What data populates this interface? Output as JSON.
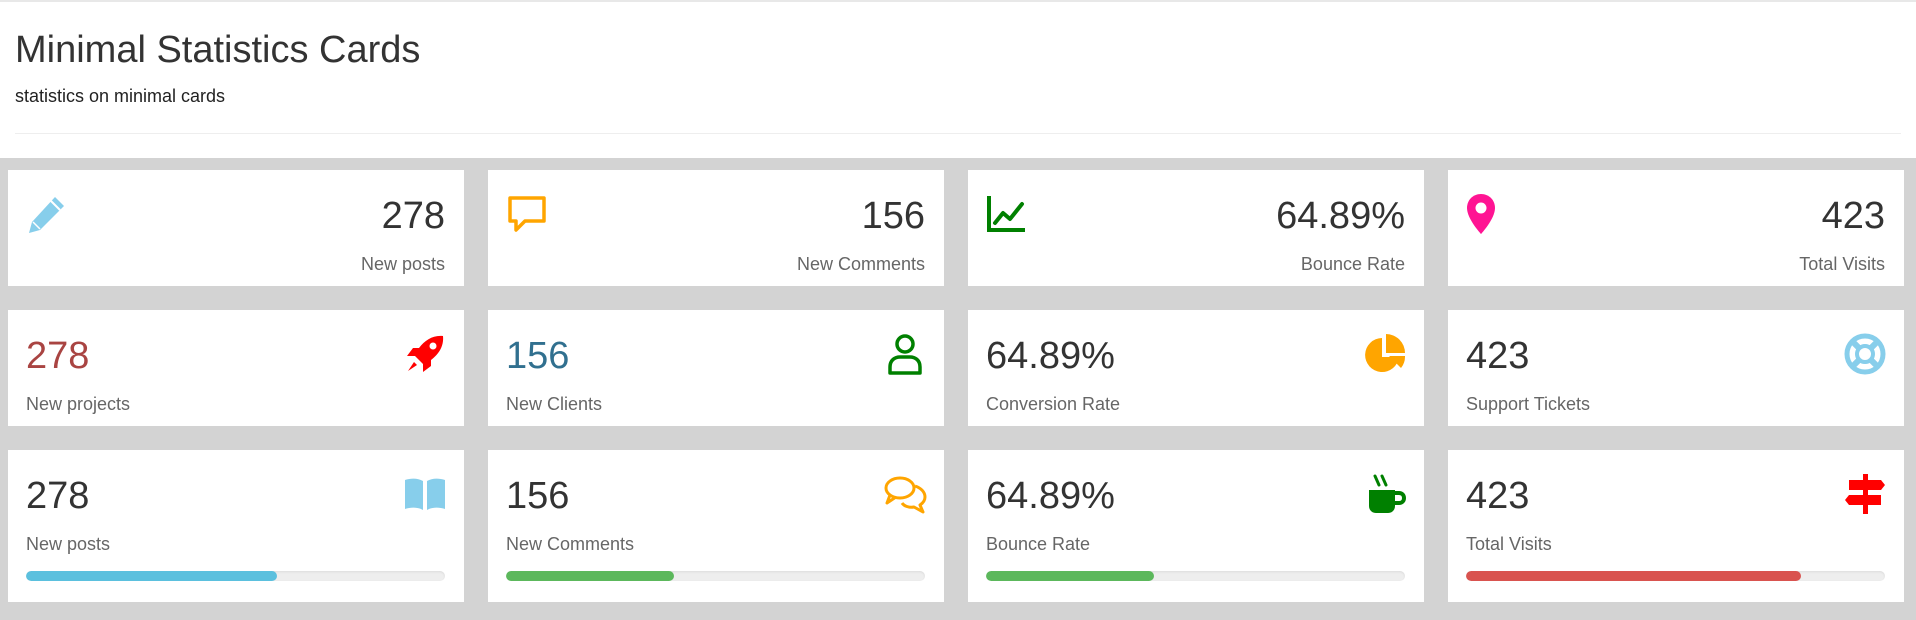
{
  "header": {
    "title": "Minimal Statistics Cards",
    "subtitle": "statistics on minimal cards"
  },
  "row1": [
    {
      "value": "278",
      "label": "New posts",
      "icon": "pencil-icon",
      "icon_color": "#87ceeb"
    },
    {
      "value": "156",
      "label": "New Comments",
      "icon": "comment-icon",
      "icon_color": "#ffa500"
    },
    {
      "value": "64.89%",
      "label": "Bounce Rate",
      "icon": "line-chart-icon",
      "icon_color": "#008000"
    },
    {
      "value": "423",
      "label": "Total Visits",
      "icon": "map-pin-icon",
      "icon_color": "#ff1493"
    }
  ],
  "row2": [
    {
      "value": "278",
      "label": "New projects",
      "icon": "rocket-icon",
      "icon_color": "#ff0000",
      "value_color": "#a94442"
    },
    {
      "value": "156",
      "label": "New Clients",
      "icon": "user-icon",
      "icon_color": "#008000",
      "value_color": "#31708f"
    },
    {
      "value": "64.89%",
      "label": "Conversion Rate",
      "icon": "pie-chart-icon",
      "icon_color": "#ffa500",
      "value_color": "#333333"
    },
    {
      "value": "423",
      "label": "Support Tickets",
      "icon": "life-ring-icon",
      "icon_color": "#87ceeb",
      "value_color": "#333333"
    }
  ],
  "row3": [
    {
      "value": "278",
      "label": "New posts",
      "icon": "book-open-icon",
      "icon_color": "#87ceeb",
      "progress": 0.6,
      "bar_color": "#5bc0de"
    },
    {
      "value": "156",
      "label": "New Comments",
      "icon": "comments-icon",
      "icon_color": "#ffa500",
      "progress": 0.4,
      "bar_color": "#5cb85c"
    },
    {
      "value": "64.89%",
      "label": "Bounce Rate",
      "icon": "coffee-cup-icon",
      "icon_color": "#008000",
      "progress": 0.4,
      "bar_color": "#5cb85c"
    },
    {
      "value": "423",
      "label": "Total Visits",
      "icon": "signpost-icon",
      "icon_color": "#ff0000",
      "progress": 0.8,
      "bar_color": "#d9534f"
    }
  ]
}
